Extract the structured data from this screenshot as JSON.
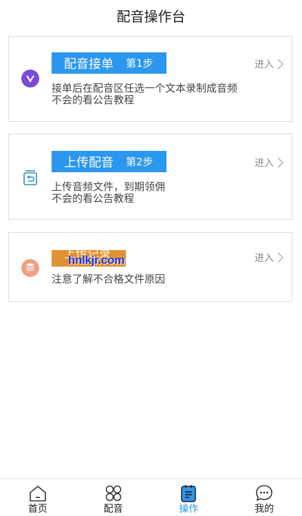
{
  "header": {
    "title": "配音操作台"
  },
  "cards": [
    {
      "title": "配音接单",
      "step": "第1步",
      "enter": "进入",
      "desc_line1": "接单后在配音区任选一个文本录制成音频",
      "desc_line2": "不会的看公告教程",
      "icon": "v-logo-icon",
      "icon_color": "#7a4bd6",
      "pill_color": "#2b97ee"
    },
    {
      "title": "上传配音",
      "step": "第2步",
      "enter": "进入",
      "desc_line1": "上传音频文件，到期领佣",
      "desc_line2": "不会的看公告教程",
      "icon": "upload-box-icon",
      "icon_color": "#2b8fb3",
      "pill_color": "#2b97ee"
    },
    {
      "title": "上传记录",
      "enter": "进入",
      "desc_line1": "注意了解不合格文件原因",
      "watermark": "hnlkjr.com",
      "icon": "database-icon",
      "icon_color": "#f0a084",
      "pill_color": "#df9233"
    }
  ],
  "bottom_nav": [
    {
      "label": "首页",
      "icon": "home-icon",
      "active": false
    },
    {
      "label": "配音",
      "icon": "grid-icon",
      "active": false
    },
    {
      "label": "操作",
      "icon": "clipboard-icon",
      "active": true
    },
    {
      "label": "我的",
      "icon": "chat-bubble-icon",
      "active": false
    }
  ],
  "colors": {
    "accent": "#2b97ee",
    "orange": "#df9233",
    "text": "#444444",
    "muted": "#8a8a8a"
  }
}
